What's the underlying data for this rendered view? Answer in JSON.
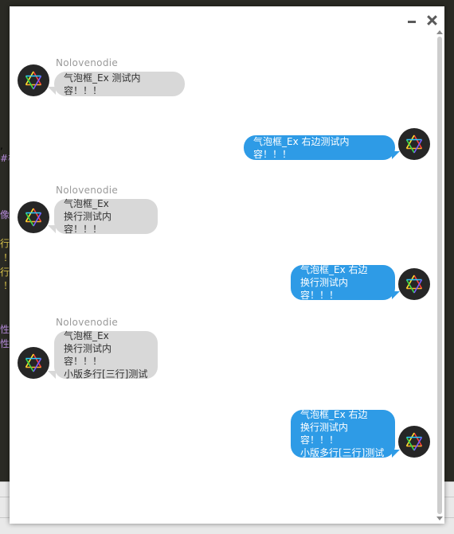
{
  "background": {
    "left_fragments": [
      {
        "text": ",",
        "color": "#cfcfcf"
      },
      {
        "text": "#核",
        "color": "#b48ad8"
      },
      {
        "text": "像",
        "color": "#b48ad8"
      },
      {
        "text": "行",
        "color": "#d8c24a"
      },
      {
        "text": "！",
        "color": "#d8c24a"
      },
      {
        "text": "行",
        "color": "#d8c24a"
      },
      {
        "text": "！",
        "color": "#d8c24a"
      },
      {
        "text": "性",
        "color": "#b48ad8"
      },
      {
        "text": "性",
        "color": "#b48ad8"
      }
    ]
  },
  "window": {
    "minimize_icon": "minimize-icon",
    "close_icon": "close-icon"
  },
  "messages": [
    {
      "side": "left",
      "sender": "Nolovenodie",
      "text": "气泡框_Ex 测试内容！！！"
    },
    {
      "side": "right",
      "sender": "",
      "text": "气泡框_Ex 右边测试内容！！！"
    },
    {
      "side": "left",
      "sender": "Nolovenodie",
      "text": "气泡框_Ex\n换行测试内容！！！"
    },
    {
      "side": "right",
      "sender": "",
      "text": "气泡框_Ex 右边\n换行测试内容！！！"
    },
    {
      "side": "left",
      "sender": "Nolovenodie",
      "text": "气泡框_Ex\n换行测试内容！！！\n小版多行[三行]测试"
    },
    {
      "side": "right",
      "sender": "",
      "text": "气泡框_Ex 右边\n换行测试内容！！！\n小版多行[三行]测试"
    }
  ],
  "avatar_icon": "hexagram-avatar-icon"
}
